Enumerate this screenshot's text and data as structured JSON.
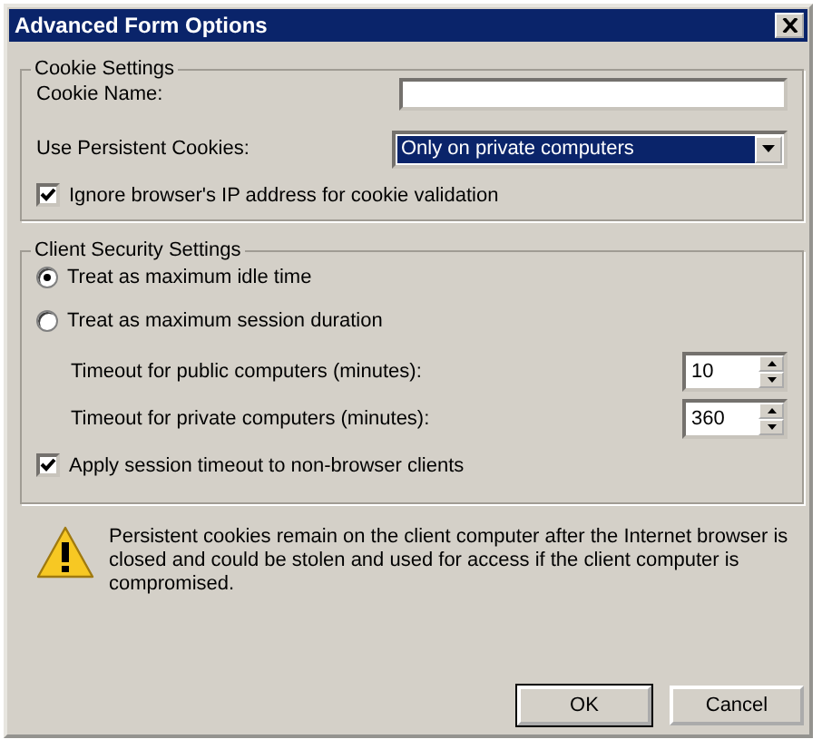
{
  "window": {
    "title": "Advanced Form Options"
  },
  "cookie_settings": {
    "title": "Cookie Settings",
    "fields": [
      {
        "kind": "text",
        "label": "Cookie Name:"
      },
      {
        "kind": "dropdown",
        "label": "Use Persistent Cookies:",
        "value": "Only on private computers"
      }
    ],
    "options": [
      {
        "label": "Ignore browser's IP address for cookie validation",
        "checked": true
      }
    ]
  },
  "client_security": {
    "title": "Client Security Settings",
    "modes": [
      {
        "label": "Treat as maximum idle time",
        "selected": true
      },
      {
        "label": "Treat as maximum session duration",
        "selected": false
      }
    ],
    "timeouts": [
      {
        "label": "Timeout for public computers (minutes):",
        "value": "10"
      },
      {
        "label": "Timeout for private computers (minutes):",
        "value": "360"
      }
    ],
    "options": [
      {
        "label": "Apply session timeout to non-browser clients",
        "checked": true
      }
    ]
  },
  "warning": {
    "text": "Persistent cookies remain on the client computer after the Internet browser is closed and could be stolen and used for access if the client computer is compromised."
  },
  "buttons": [
    {
      "label": "OK",
      "default": true
    },
    {
      "label": "Cancel",
      "default": false
    }
  ]
}
